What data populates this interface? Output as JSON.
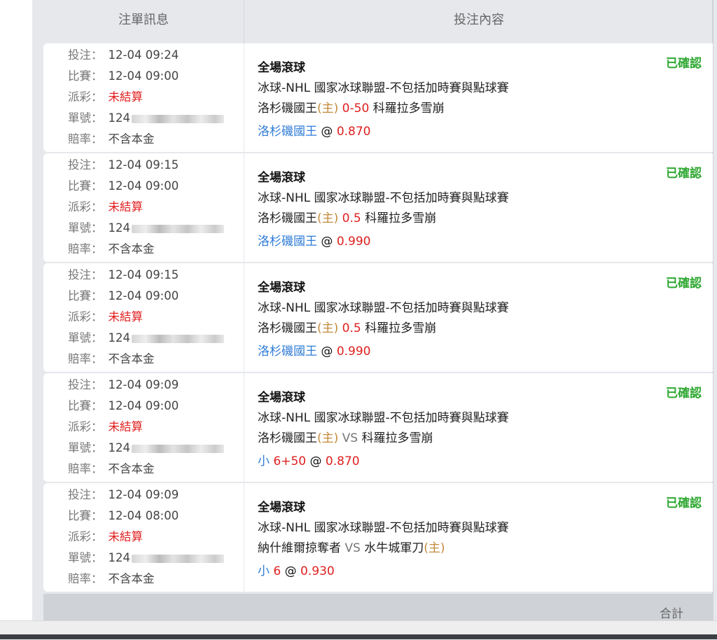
{
  "header": {
    "info": "注單訊息",
    "content": "投注內容"
  },
  "labels": {
    "bet_time": "投注：",
    "match_time": "比賽：",
    "payout": "派彩：",
    "ticket": "單號：",
    "odds_type": "賠率："
  },
  "rows": [
    {
      "bet_time": "12-04 09:24",
      "match_time": "12-04 09:00",
      "payout": "未結算",
      "ticket": "124",
      "odds_type": "不含本金",
      "bet_type": "全場滾球",
      "league": "冰球-NHL 國家冰球聯盟-不包括加時賽與點球賽",
      "team1": "洛杉磯國王",
      "team1_tag": "(主)",
      "handicap": "0-50",
      "team2": "科羅拉多雪崩",
      "team2_tag": "",
      "pick": "洛杉磯國王",
      "pick_line": "",
      "at": "@",
      "odds": "0.870",
      "status": "已確認"
    },
    {
      "bet_time": "12-04 09:15",
      "match_time": "12-04 09:00",
      "payout": "未結算",
      "ticket": "124",
      "odds_type": "不含本金",
      "bet_type": "全場滾球",
      "league": "冰球-NHL 國家冰球聯盟-不包括加時賽與點球賽",
      "team1": "洛杉磯國王",
      "team1_tag": "(主)",
      "handicap": "0.5",
      "team2": "科羅拉多雪崩",
      "team2_tag": "",
      "pick": "洛杉磯國王",
      "pick_line": "",
      "at": "@",
      "odds": "0.990",
      "status": "已確認"
    },
    {
      "bet_time": "12-04 09:15",
      "match_time": "12-04 09:00",
      "payout": "未結算",
      "ticket": "124",
      "odds_type": "不含本金",
      "bet_type": "全場滾球",
      "league": "冰球-NHL 國家冰球聯盟-不包括加時賽與點球賽",
      "team1": "洛杉磯國王",
      "team1_tag": "(主)",
      "handicap": "0.5",
      "team2": "科羅拉多雪崩",
      "team2_tag": "",
      "pick": "洛杉磯國王",
      "pick_line": "",
      "at": "@",
      "odds": "0.990",
      "status": "已確認"
    },
    {
      "bet_time": "12-04 09:09",
      "match_time": "12-04 09:00",
      "payout": "未結算",
      "ticket": "124",
      "odds_type": "不含本金",
      "bet_type": "全場滾球",
      "league": "冰球-NHL 國家冰球聯盟-不包括加時賽與點球賽",
      "team1": "洛杉磯國王",
      "team1_tag": "(主)",
      "handicap": "VS",
      "team2": "科羅拉多雪崩",
      "team2_tag": "",
      "pick": "小",
      "pick_line": "6+50",
      "at": "@",
      "odds": "0.870",
      "status": "已確認"
    },
    {
      "bet_time": "12-04 09:09",
      "match_time": "12-04 08:00",
      "payout": "未結算",
      "ticket": "124",
      "odds_type": "不含本金",
      "bet_type": "全場滾球",
      "league": "冰球-NHL 國家冰球聯盟-不包括加時賽與點球賽",
      "team1": "納什維爾掠奪者",
      "team1_tag": "",
      "handicap": "VS",
      "team2": "水牛城軍刀",
      "team2_tag": "(主)",
      "pick": "小",
      "pick_line": "6",
      "at": "@",
      "odds": "0.930",
      "status": "已確認"
    }
  ],
  "footer": {
    "total_label": "合計"
  }
}
